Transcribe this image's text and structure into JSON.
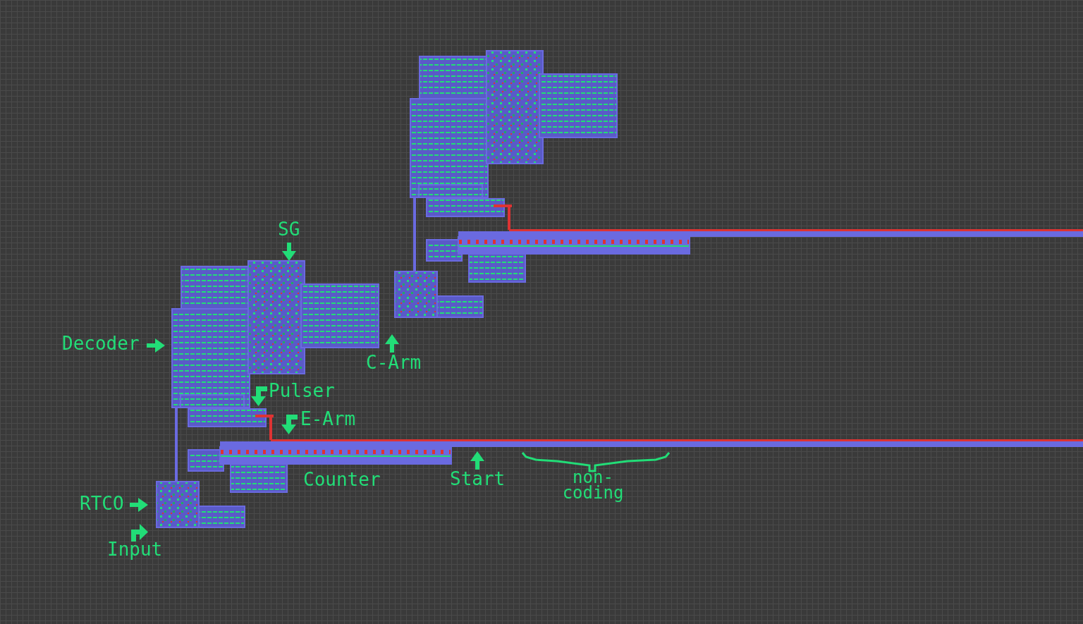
{
  "canvas": {
    "labels": [
      {
        "text": "SG",
        "kind": "down"
      },
      {
        "text": "Decoder",
        "kind": "right"
      },
      {
        "text": "C-Arm",
        "kind": "up"
      },
      {
        "text": "Pulser",
        "kind": "down-left"
      },
      {
        "text": "E-Arm",
        "kind": "down-left"
      },
      {
        "text": "Counter",
        "kind": "none"
      },
      {
        "text": "Start",
        "kind": "up"
      },
      {
        "text": "non-coding",
        "kind": "brace"
      },
      {
        "text": "RTCO",
        "kind": "right"
      },
      {
        "text": "Input",
        "kind": "up-right"
      }
    ]
  }
}
